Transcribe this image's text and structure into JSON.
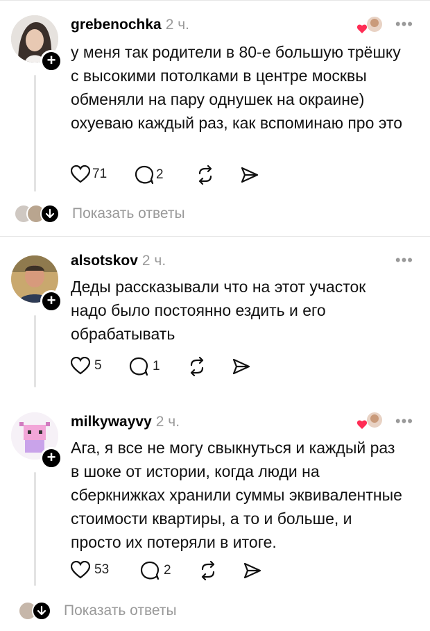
{
  "comments": [
    {
      "username": "grebenochka",
      "time": "2 ч.",
      "text": "у меня так родители в 80-е большую трёшку с высокими потолками в центре москвы обменяли на пару однушек на окраине) охуеваю каждый раз, как вспоминаю про это",
      "likes": "71",
      "replies": "2",
      "show_replies": "Показать ответы"
    },
    {
      "username": "alsotskov",
      "time": "2 ч.",
      "text": "Деды рассказывали что на этот участок надо было постоянно ездить и его обрабатывать",
      "likes": "5",
      "replies": "1"
    },
    {
      "username": "milkywayvy",
      "time": "2 ч.",
      "text": "Ага, я все не могу свыкнуться и каждый раз в шоке от истории, когда люди на сберкнижках хранили суммы эквивалентные стоимости квартиры, а то и больше, и просто их потеряли в итоге.",
      "likes": "53",
      "replies": "2",
      "show_replies": "Показать ответы"
    }
  ],
  "more_glyph": "•••",
  "plus_glyph": "+",
  "colors": {
    "heart": "#ff2d55",
    "secondary_text": "#999999",
    "divider": "#e6e6e6"
  }
}
